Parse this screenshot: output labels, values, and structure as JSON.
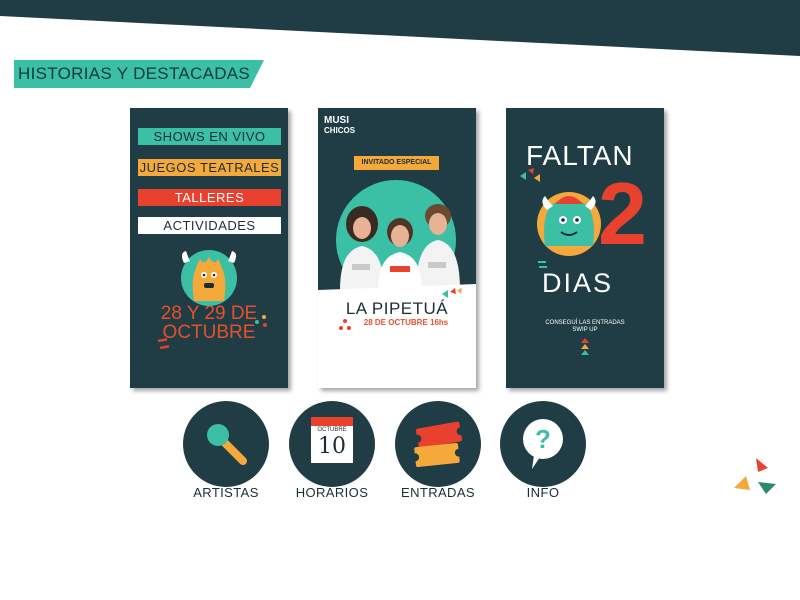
{
  "header": {
    "title": "HISTORIAS Y DESTACADAS"
  },
  "stories": [
    {
      "items": [
        "SHOWS EN VIVO",
        "JUEGOS TEATRALES",
        "TALLERES",
        "ACTIVIDADES"
      ],
      "date_line1": "28 Y 29 DE",
      "date_line2": "OCTUBRE"
    },
    {
      "logo_line1": "MUSI",
      "logo_line2": "CHICOS",
      "badge": "INVITADO ESPECIAL",
      "artist": "LA PIPETUÁ",
      "date": "28 DE OCTUBRE 16hs"
    },
    {
      "line1": "FALTAN",
      "number": "2",
      "line2": "DIAS",
      "cta_line1": "CONSEGUÍ LAS ENTRADAS",
      "cta_line2": "SWIP UP"
    }
  ],
  "nav": [
    {
      "label": "ARTISTAS",
      "icon": "microphone-icon"
    },
    {
      "label": "HORARIOS",
      "icon": "calendar-icon",
      "calendar_month": "OCTUBRE",
      "calendar_day": "10"
    },
    {
      "label": "ENTRADAS",
      "icon": "ticket-icon"
    },
    {
      "label": "INFO",
      "icon": "question-bubble-icon"
    }
  ],
  "colors": {
    "dark": "#203d46",
    "teal": "#3bbfa5",
    "orange": "#f5a93b",
    "red": "#e8412e",
    "white": "#ffffff"
  }
}
